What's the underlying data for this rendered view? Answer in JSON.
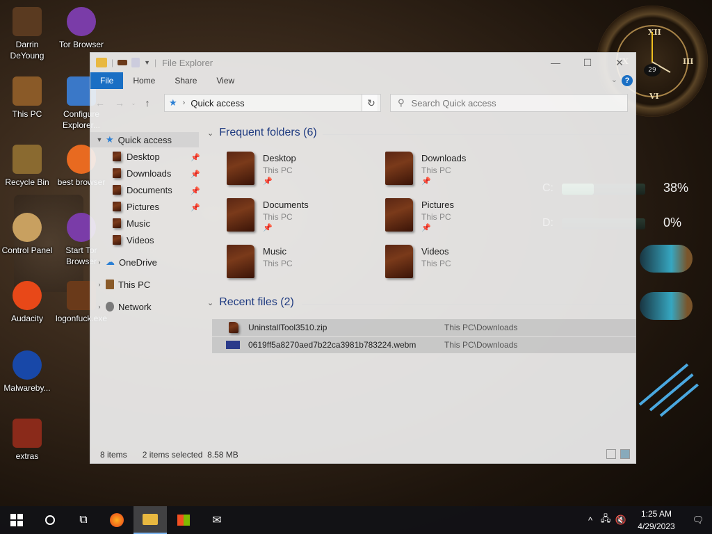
{
  "desktop": {
    "icons": [
      {
        "label": "Darrin DeYoung",
        "color": "#5a3a20"
      },
      {
        "label": "Tor Browser",
        "color": "#7a3ca8"
      },
      {
        "label": "This PC",
        "color": "#8a5a28"
      },
      {
        "label": "Configure Explorer...",
        "color": "#3a78c8"
      },
      {
        "label": "Recycle Bin",
        "color": "#8a6a30"
      },
      {
        "label": "best browser",
        "color": "#e86a20"
      },
      {
        "label": "Control Panel",
        "color": "#c8a060"
      },
      {
        "label": "Start Tor Browser",
        "color": "#7a3ca8"
      },
      {
        "label": "Audacity",
        "color": "#e84818"
      },
      {
        "label": "logonfuck.exe",
        "color": "#6a3a1a"
      },
      {
        "label": "Malwareby...",
        "color": "#1848a8"
      },
      {
        "label": "extras",
        "color": "#8a2a1a"
      }
    ],
    "gauge": {
      "clock_day": "29",
      "drives": [
        {
          "letter": "C:",
          "percent": "38%",
          "fill": 0.38
        },
        {
          "letter": "D:",
          "percent": "0%",
          "fill": 0.0
        }
      ]
    }
  },
  "explorer": {
    "title": "File Explorer",
    "ribbon_tabs": [
      "File",
      "Home",
      "Share",
      "View"
    ],
    "address": "Quick access",
    "search_placeholder": "Search Quick access",
    "nav": {
      "quick_access": "Quick access",
      "pinned": [
        "Desktop",
        "Downloads",
        "Documents",
        "Pictures",
        "Music",
        "Videos"
      ],
      "onedrive": "OneDrive",
      "this_pc": "This PC",
      "network": "Network"
    },
    "frequent": {
      "header": "Frequent folders (6)",
      "folders": [
        {
          "name": "Desktop",
          "location": "This PC"
        },
        {
          "name": "Downloads",
          "location": "This PC"
        },
        {
          "name": "Documents",
          "location": "This PC"
        },
        {
          "name": "Pictures",
          "location": "This PC"
        },
        {
          "name": "Music",
          "location": "This PC"
        },
        {
          "name": "Videos",
          "location": "This PC"
        }
      ]
    },
    "recent": {
      "header": "Recent files (2)",
      "files": [
        {
          "name": "UninstallTool3510.zip",
          "path": "This PC\\Downloads"
        },
        {
          "name": "0619ff5a8270aed7b22ca3981b783224.webm",
          "path": "This PC\\Downloads"
        }
      ]
    },
    "status": {
      "items": "8 items",
      "selection": "2 items selected  8.58 MB"
    }
  },
  "taskbar": {
    "time": "1:25 AM",
    "date": "4/29/2023",
    "accent": "#7ab4f0"
  }
}
